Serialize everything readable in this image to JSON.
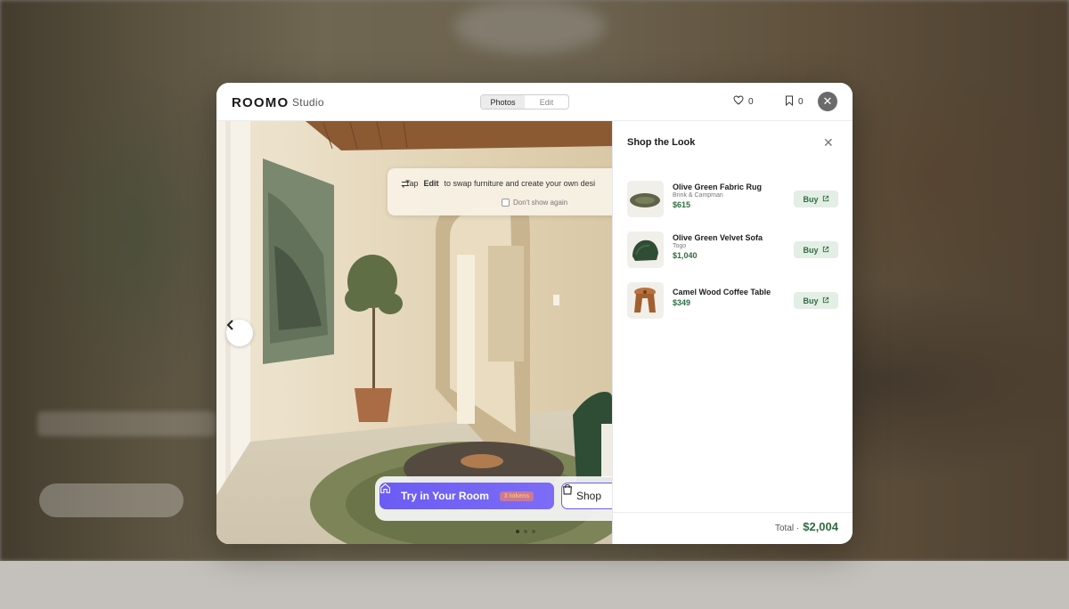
{
  "header": {
    "brand": "ROOMO",
    "brand_sub": "Studio",
    "tabs": [
      {
        "label": "Photos",
        "active": true
      },
      {
        "label": "Edit",
        "active": false
      }
    ],
    "likes_count": "0",
    "saves_count": "0",
    "icons": {
      "like": "heart-icon",
      "save": "bookmark-icon",
      "close": "close-icon"
    }
  },
  "tip": {
    "prefix": "Tap",
    "bold": "Edit",
    "suffix": "to swap furniture and create your own desi",
    "checkbox_label": "Don't show again"
  },
  "actions": {
    "try_label": "Try in Your Room",
    "tokens_label": "3 tokens",
    "shop_label": "Shop"
  },
  "carousel": {
    "dots": 3,
    "active_dot": 0
  },
  "shop_panel": {
    "title": "Shop the Look",
    "items": [
      {
        "name": "Olive Green Fabric Rug",
        "brand": "Brink & Campman",
        "price": "$615",
        "buy_label": "Buy"
      },
      {
        "name": "Olive Green Velvet Sofa",
        "brand": "Togo",
        "price": "$1,040",
        "buy_label": "Buy"
      },
      {
        "name": "Camel Wood Coffee Table",
        "brand": "",
        "price": "$349",
        "buy_label": "Buy"
      }
    ],
    "total_label": "Total ·",
    "total_value": "$2,004"
  },
  "colors": {
    "accent_purple": "#6b5cf4",
    "price_green": "#2f6c3f",
    "buy_bg": "#e3eee5"
  }
}
